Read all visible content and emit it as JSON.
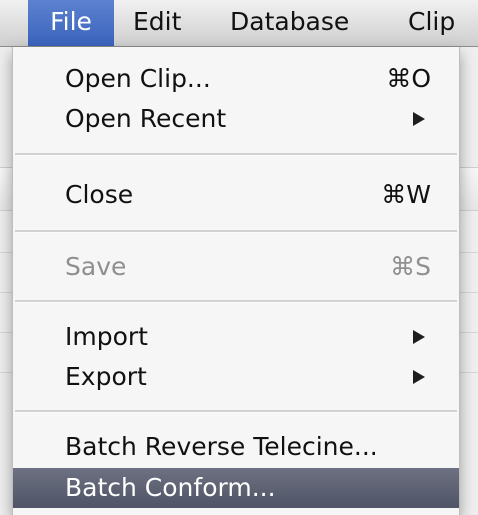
{
  "menubar": {
    "items": [
      {
        "label": "File",
        "active": true
      },
      {
        "label": "Edit"
      },
      {
        "label": "Database"
      },
      {
        "label": "Clip"
      }
    ]
  },
  "file_menu": {
    "items": [
      {
        "label": "Open Clip...",
        "shortcut": "⌘O"
      },
      {
        "label": "Open Recent",
        "submenu": true
      },
      {
        "label": "Close",
        "shortcut": "⌘W"
      },
      {
        "label": "Save",
        "shortcut": "⌘S",
        "disabled": true
      },
      {
        "label": "Import",
        "submenu": true
      },
      {
        "label": "Export",
        "submenu": true
      },
      {
        "label": "Batch Reverse Telecine..."
      },
      {
        "label": "Batch Conform...",
        "highlighted": true
      }
    ]
  },
  "colors": {
    "menubar_highlight": "#3a63bd",
    "menu_item_highlight": "#4f5466",
    "disabled_text": "#8f8f8f"
  }
}
